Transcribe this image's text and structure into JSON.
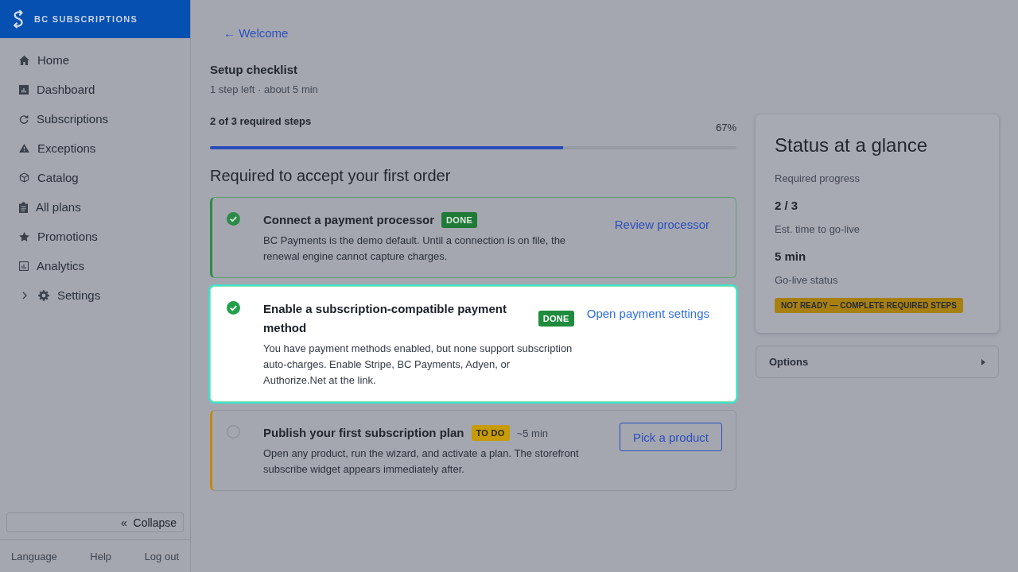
{
  "sidebar": {
    "brand": "BC SUBSCRIPTIONS",
    "nav": [
      {
        "label": "Home",
        "selected": false
      },
      {
        "label": "Dashboard",
        "selected": false
      },
      {
        "label": "Subscriptions",
        "selected": false
      },
      {
        "label": "Exceptions",
        "selected": false
      },
      {
        "label": "Catalog",
        "selected": false
      },
      {
        "label": "All plans",
        "selected": false
      },
      {
        "label": "Promotions",
        "selected": false
      },
      {
        "label": "Analytics",
        "selected": false
      },
      {
        "label": "Settings",
        "selected": false,
        "expanded": false
      }
    ],
    "collapse": {
      "glyph": "«",
      "label": "Collapse"
    },
    "footer_links": [
      "Language",
      "Help",
      "Log out"
    ]
  },
  "back_link": "← Welcome",
  "checklist": {
    "title": "Setup checklist",
    "subtitle": "1 step left · about 5 min",
    "progress": {
      "label": "2 of 3 required steps",
      "percent": "67%",
      "level": 0.67
    }
  },
  "section_title": "Required to accept your first order",
  "steps": [
    {
      "title": "Connect a payment processor",
      "kind": "done",
      "badge": "DONE",
      "description": "BC Payments is the demo default. Until a connection is on file, the renewal engine cannot capture charges.",
      "highlighted": false,
      "action": {
        "kind": "link",
        "label": "Review processor"
      }
    },
    {
      "title": "Enable a subscription-compatible payment method",
      "kind": "done",
      "badge": "DONE",
      "description": "You have payment methods enabled, but none support subscription auto-charges. Enable Stripe, BC Payments, Adyen, or Authorize.Net at the link.",
      "highlighted": true,
      "action": {
        "kind": "link",
        "label": "Open payment settings"
      }
    },
    {
      "title": "Publish your first subscription plan",
      "kind": "todo",
      "badge": "TO DO",
      "estimate": "~5 min",
      "description": "Open any product, run the wizard, and activate a plan. The storefront subscribe widget appears immediately after.",
      "highlighted": false,
      "action": {
        "kind": "button",
        "label": "Pick a product"
      }
    }
  ],
  "status_panel": {
    "title": "Status at a glance",
    "stats": [
      {
        "label": "Required progress",
        "value": "2 / 3"
      },
      {
        "label": "Est. time to go-live",
        "value": "5 min"
      }
    ],
    "go_live": {
      "label": "Go-live status",
      "badge": "NOT READY — COMPLETE REQUIRED STEPS"
    }
  },
  "options": {
    "label": "Options",
    "expanded": false
  }
}
